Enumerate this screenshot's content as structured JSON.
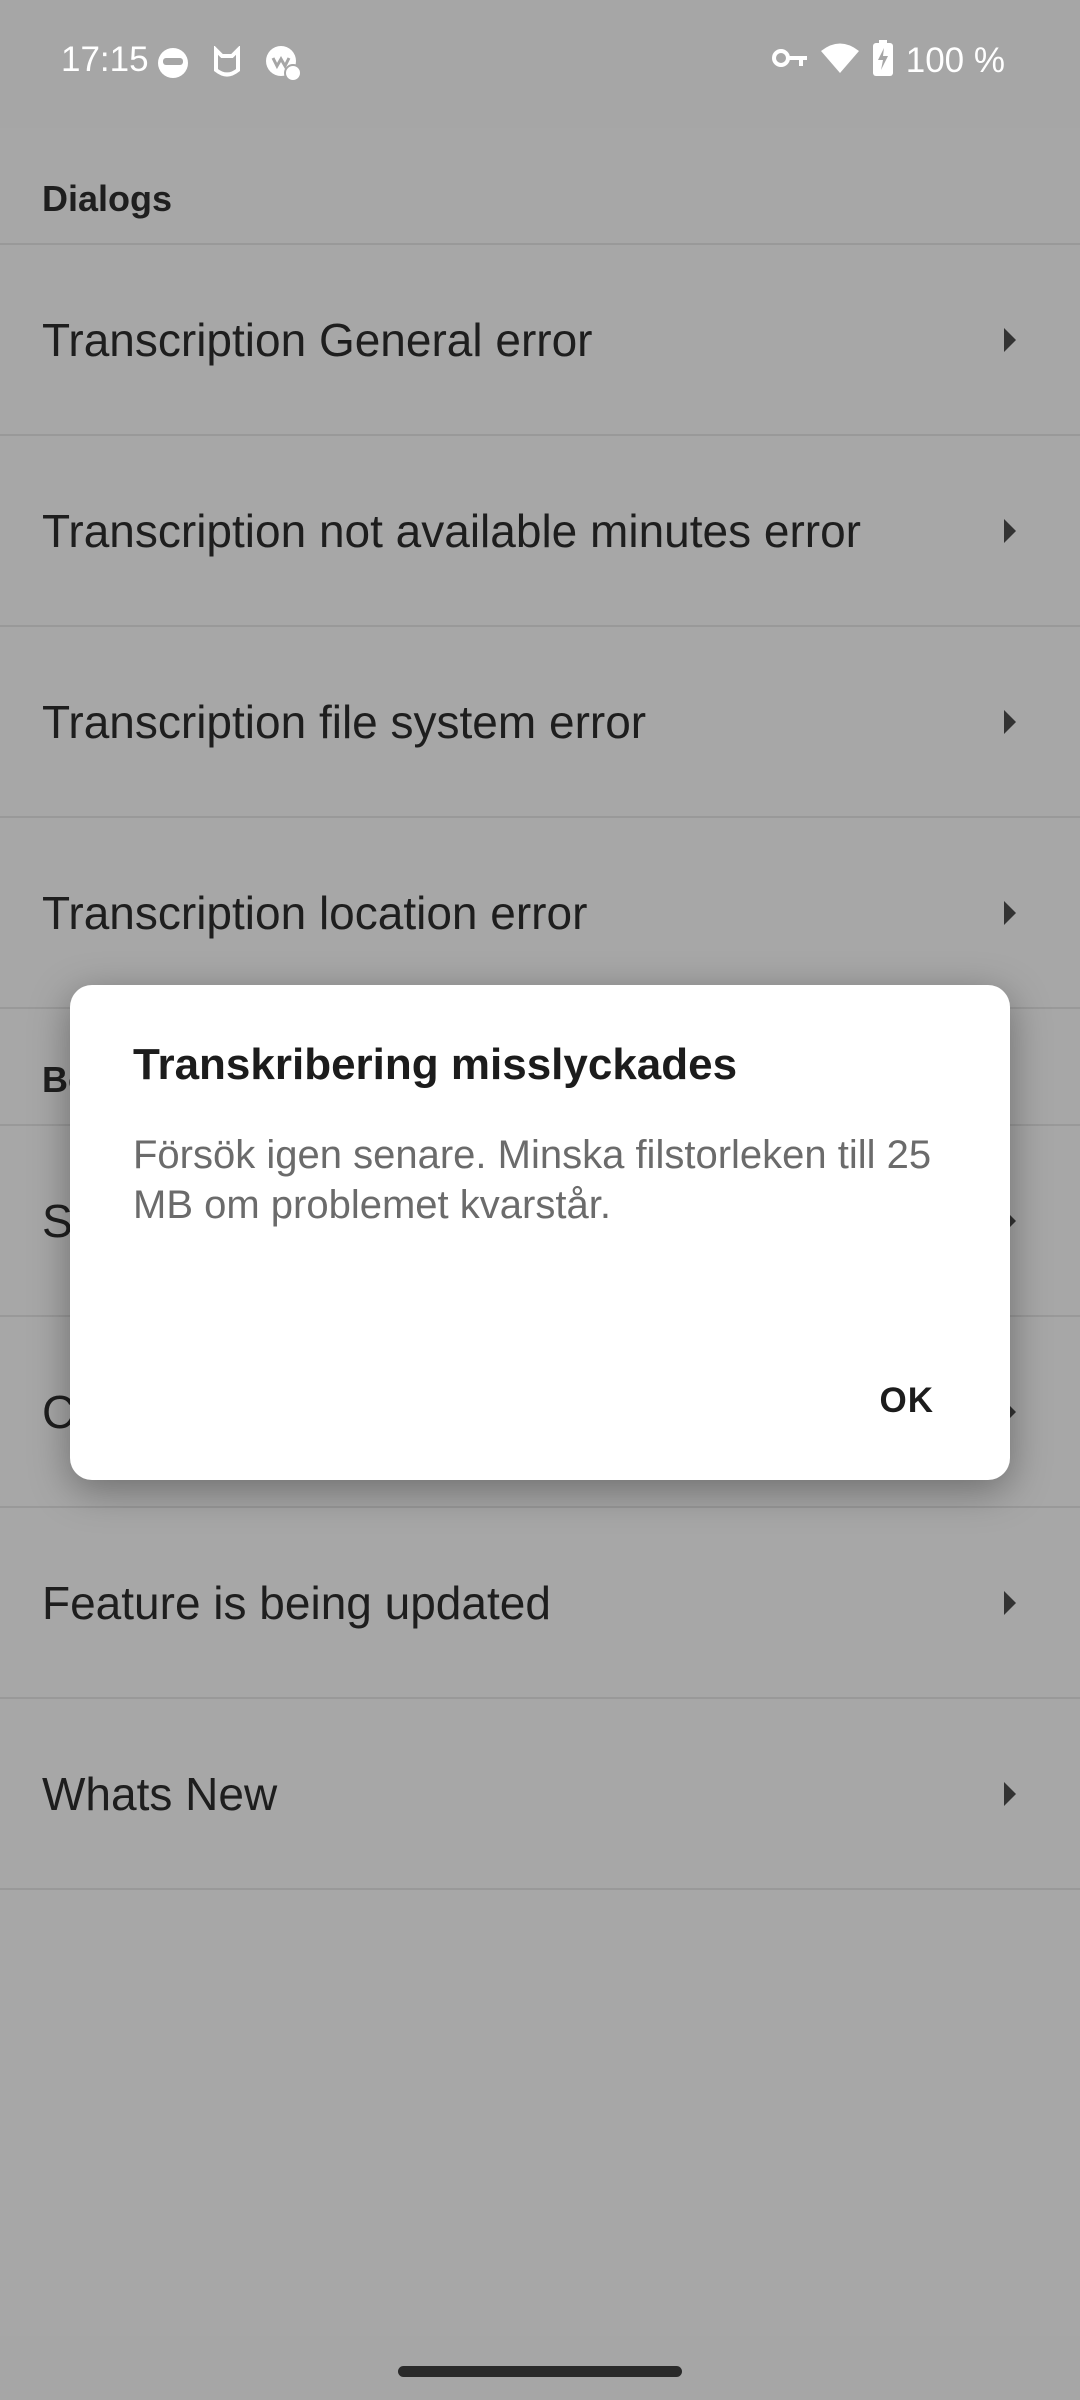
{
  "status_bar": {
    "time": "17:15",
    "battery_text": "100 %",
    "left_icons": [
      "mask-icon",
      "cat-face-icon",
      "badge-check-icon"
    ],
    "right_icons": [
      "vpn-key-icon",
      "wifi-icon",
      "battery-charging-icon"
    ]
  },
  "sections": [
    {
      "header": "Dialogs",
      "items": [
        {
          "label": "Transcription General error"
        },
        {
          "label": "Transcription not available minutes error"
        },
        {
          "label": "Transcription file system error"
        },
        {
          "label": "Transcription location error"
        }
      ]
    },
    {
      "header": "Bo",
      "items": [
        {
          "label": "S"
        },
        {
          "label": "C"
        },
        {
          "label": "Feature is being updated"
        },
        {
          "label": "Whats New"
        }
      ]
    }
  ],
  "dialog": {
    "title": "Transkribering misslyckades",
    "message": "Försök igen senare. Minska filstorleken till 25 MB om problemet kvarstår.",
    "ok_label": "OK"
  }
}
